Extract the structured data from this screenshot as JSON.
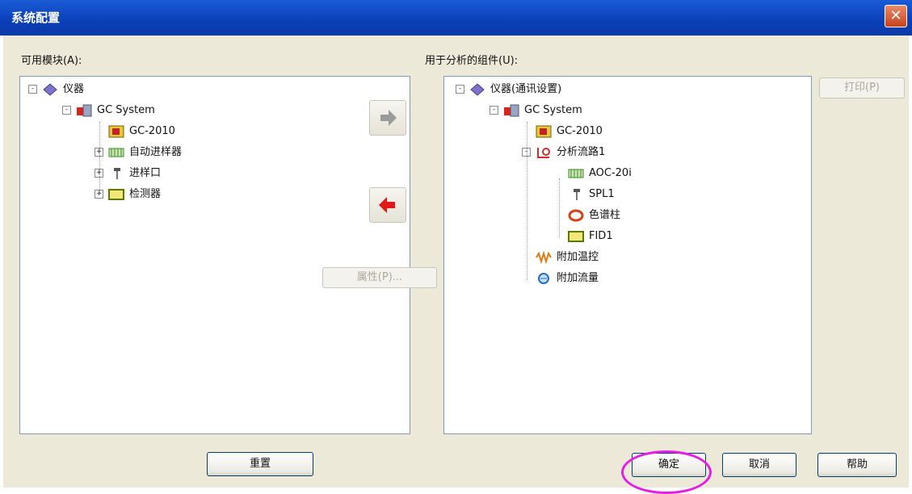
{
  "window": {
    "title": "系统配置",
    "close": "✕"
  },
  "left": {
    "label": "可用模块(A):",
    "tree": [
      {
        "expander": "-",
        "icon": "instrument-icon",
        "text": "仪器"
      },
      {
        "expander": "-",
        "icon": "gc-system-icon",
        "text": "GC System"
      },
      {
        "expander": "",
        "icon": "gc-2010-icon",
        "text": "GC-2010"
      },
      {
        "expander": "+",
        "icon": "autosampler-icon",
        "text": "自动进样器"
      },
      {
        "expander": "+",
        "icon": "injector-icon",
        "text": "进样口"
      },
      {
        "expander": "+",
        "icon": "detector-icon",
        "text": "检测器"
      }
    ],
    "button": "重置"
  },
  "middle": {
    "add_icon": "right-arrow-icon",
    "remove_icon": "left-arrow-icon",
    "properties": "属性(P)..."
  },
  "right": {
    "label": "用于分析的组件(U):",
    "tree": [
      {
        "expander": "-",
        "icon": "instrument-icon",
        "text": "仪器(通讯设置)"
      },
      {
        "expander": "-",
        "icon": "gc-system-icon",
        "text": "GC System"
      },
      {
        "expander": "",
        "icon": "gc-2010-icon",
        "text": "GC-2010"
      },
      {
        "expander": "-",
        "icon": "analysis-line-icon",
        "text": "分析流路1"
      },
      {
        "expander": "",
        "icon": "autosampler-icon",
        "text": "AOC-20i"
      },
      {
        "expander": "",
        "icon": "injector-icon",
        "text": "SPL1"
      },
      {
        "expander": "",
        "icon": "column-icon",
        "text": "色谱柱"
      },
      {
        "expander": "",
        "icon": "detector-icon",
        "text": "FID1"
      },
      {
        "expander": "",
        "icon": "heater-icon",
        "text": "附加温控"
      },
      {
        "expander": "",
        "icon": "flow-icon",
        "text": "附加流量"
      }
    ],
    "side_button": "打印(P)"
  },
  "footer": {
    "ok": "确定",
    "cancel": "取消",
    "help": "帮助"
  },
  "colors": {
    "titlebar": "#0a3fb8",
    "highlight_ring": "#e41ee4",
    "add_arrow": "#9a9a9a",
    "remove_arrow": "#e01818"
  }
}
